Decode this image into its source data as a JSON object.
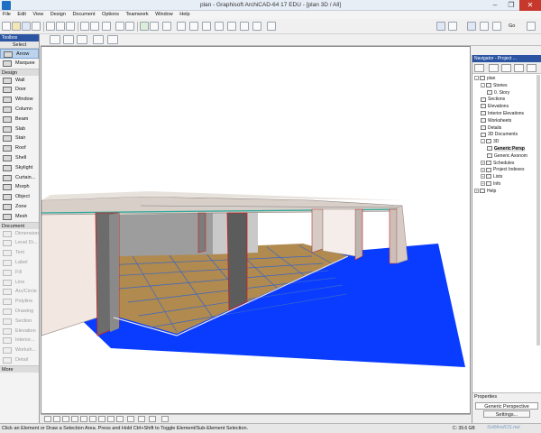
{
  "window": {
    "title": "plan - Graphisoft ArchiCAD-64 17 EDU - [plan 3D / All]",
    "controls": [
      "–",
      "❐",
      "✕"
    ]
  },
  "menu": [
    "File",
    "Edit",
    "View",
    "Design",
    "Document",
    "Options",
    "Teamwork",
    "Window",
    "Help"
  ],
  "toolbox": {
    "title": "Toolbox",
    "select_label": "Select",
    "arrow_label": "Arrow",
    "marquee_label": "Marquee",
    "design_section": "Design",
    "design_tools": [
      "Wall",
      "Door",
      "Window",
      "Column",
      "Beam",
      "Slab",
      "Stair",
      "Roof",
      "Shell",
      "Skylight",
      "Curtain...",
      "Morph",
      "Object",
      "Zone",
      "Mesh"
    ],
    "document_section": "Document",
    "document_tools": [
      "Dimension",
      "Level Di...",
      "Text",
      "Label",
      "Fill",
      "Line",
      "Arc/Circle",
      "Polyline",
      "Drawing",
      "Section",
      "Elevation",
      "Interior...",
      "Worksh...",
      "Detail"
    ],
    "more_label": "More"
  },
  "navigator": {
    "title": "Navigator - Project ...",
    "tree": [
      {
        "label": "plan",
        "level": 0,
        "toggle": "-"
      },
      {
        "label": "Stories",
        "level": 1,
        "toggle": "-"
      },
      {
        "label": "0. Story",
        "level": 2,
        "toggle": ""
      },
      {
        "label": "Sections",
        "level": 1,
        "toggle": ""
      },
      {
        "label": "Elevations",
        "level": 1,
        "toggle": ""
      },
      {
        "label": "Interior Elevations",
        "level": 1,
        "toggle": ""
      },
      {
        "label": "Worksheets",
        "level": 1,
        "toggle": ""
      },
      {
        "label": "Details",
        "level": 1,
        "toggle": ""
      },
      {
        "label": "3D Documents",
        "level": 1,
        "toggle": ""
      },
      {
        "label": "3D",
        "level": 1,
        "toggle": "-"
      },
      {
        "label": "Generic Persp",
        "level": 2,
        "toggle": "",
        "selected": true
      },
      {
        "label": "Generic Axonom",
        "level": 2,
        "toggle": ""
      },
      {
        "label": "Schedules",
        "level": 1,
        "toggle": "+"
      },
      {
        "label": "Project Indexes",
        "level": 1,
        "toggle": "+"
      },
      {
        "label": "Lists",
        "level": 1,
        "toggle": "+"
      },
      {
        "label": "Info",
        "level": 1,
        "toggle": "+"
      },
      {
        "label": "Help",
        "level": 0,
        "toggle": "+"
      }
    ],
    "properties_label": "Properties",
    "properties_value": "Generic Perspective",
    "settings_button": "Settings..."
  },
  "toolbar": {
    "go_label": "Go",
    "layer_dropdown": ""
  },
  "status": {
    "message": "Click an Element or Draw a Selection Area. Press and Hold Ctrl+Shift to Toggle Element/Sub-Element Selection.",
    "disk": "C: 39.6 GB",
    "watermark": "SoftAndOS.net"
  },
  "colors": {
    "ground": "#0a3cff",
    "floor": "#b08a4e",
    "wall": "#ecdcd4",
    "roof_edge": "#2fa89a",
    "accent": "#2b55a3"
  }
}
